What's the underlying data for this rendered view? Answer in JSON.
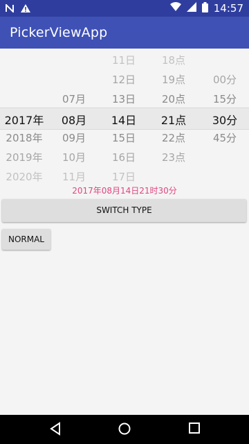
{
  "status_bar": {
    "time": "14:57",
    "left_icons": [
      "n-icon",
      "warning-icon"
    ],
    "right_icons": [
      "wifi-icon",
      "signal-icon",
      "battery-icon"
    ]
  },
  "app_bar": {
    "title": "PickerViewApp"
  },
  "picker": {
    "columns": [
      {
        "name": "year",
        "items": [
          {
            "text": "",
            "row": -3
          },
          {
            "text": "",
            "row": -2
          },
          {
            "text": "",
            "row": -1
          },
          {
            "text": "2017年",
            "row": 0,
            "selected": true
          },
          {
            "text": "2018年",
            "row": 1
          },
          {
            "text": "2019年",
            "row": 2
          },
          {
            "text": "2020年",
            "row": 3
          }
        ]
      },
      {
        "name": "month",
        "items": [
          {
            "text": "07月",
            "row": -1
          },
          {
            "text": "08月",
            "row": 0,
            "selected": true
          },
          {
            "text": "09月",
            "row": 1
          },
          {
            "text": "10月",
            "row": 2
          },
          {
            "text": "11月",
            "row": 3
          }
        ]
      },
      {
        "name": "day",
        "items": [
          {
            "text": "11日",
            "row": -3
          },
          {
            "text": "12日",
            "row": -2
          },
          {
            "text": "13日",
            "row": -1
          },
          {
            "text": "14日",
            "row": 0,
            "selected": true
          },
          {
            "text": "15日",
            "row": 1
          },
          {
            "text": "16日",
            "row": 2
          },
          {
            "text": "17日",
            "row": 3
          }
        ]
      },
      {
        "name": "hour",
        "items": [
          {
            "text": "18点",
            "row": -3
          },
          {
            "text": "19点",
            "row": -2
          },
          {
            "text": "20点",
            "row": -1
          },
          {
            "text": "21点",
            "row": 0,
            "selected": true
          },
          {
            "text": "22点",
            "row": 1
          },
          {
            "text": "23点",
            "row": 2
          }
        ]
      },
      {
        "name": "minute",
        "items": [
          {
            "text": "00分",
            "row": -2
          },
          {
            "text": "15分",
            "row": -1
          },
          {
            "text": "30分",
            "row": 0,
            "selected": true
          },
          {
            "text": "45分",
            "row": 1
          }
        ]
      }
    ]
  },
  "result_text": "2017年08月14日21时30分",
  "buttons": {
    "switch_type": "SWITCH TYPE",
    "normal": "NORMAL"
  },
  "nav_bar": {
    "items": [
      "back-icon",
      "home-icon",
      "recents-icon"
    ]
  },
  "colors": {
    "status_bar": "#2f3e9e",
    "app_bar": "#3f51b5",
    "result_text": "#e0467f"
  }
}
